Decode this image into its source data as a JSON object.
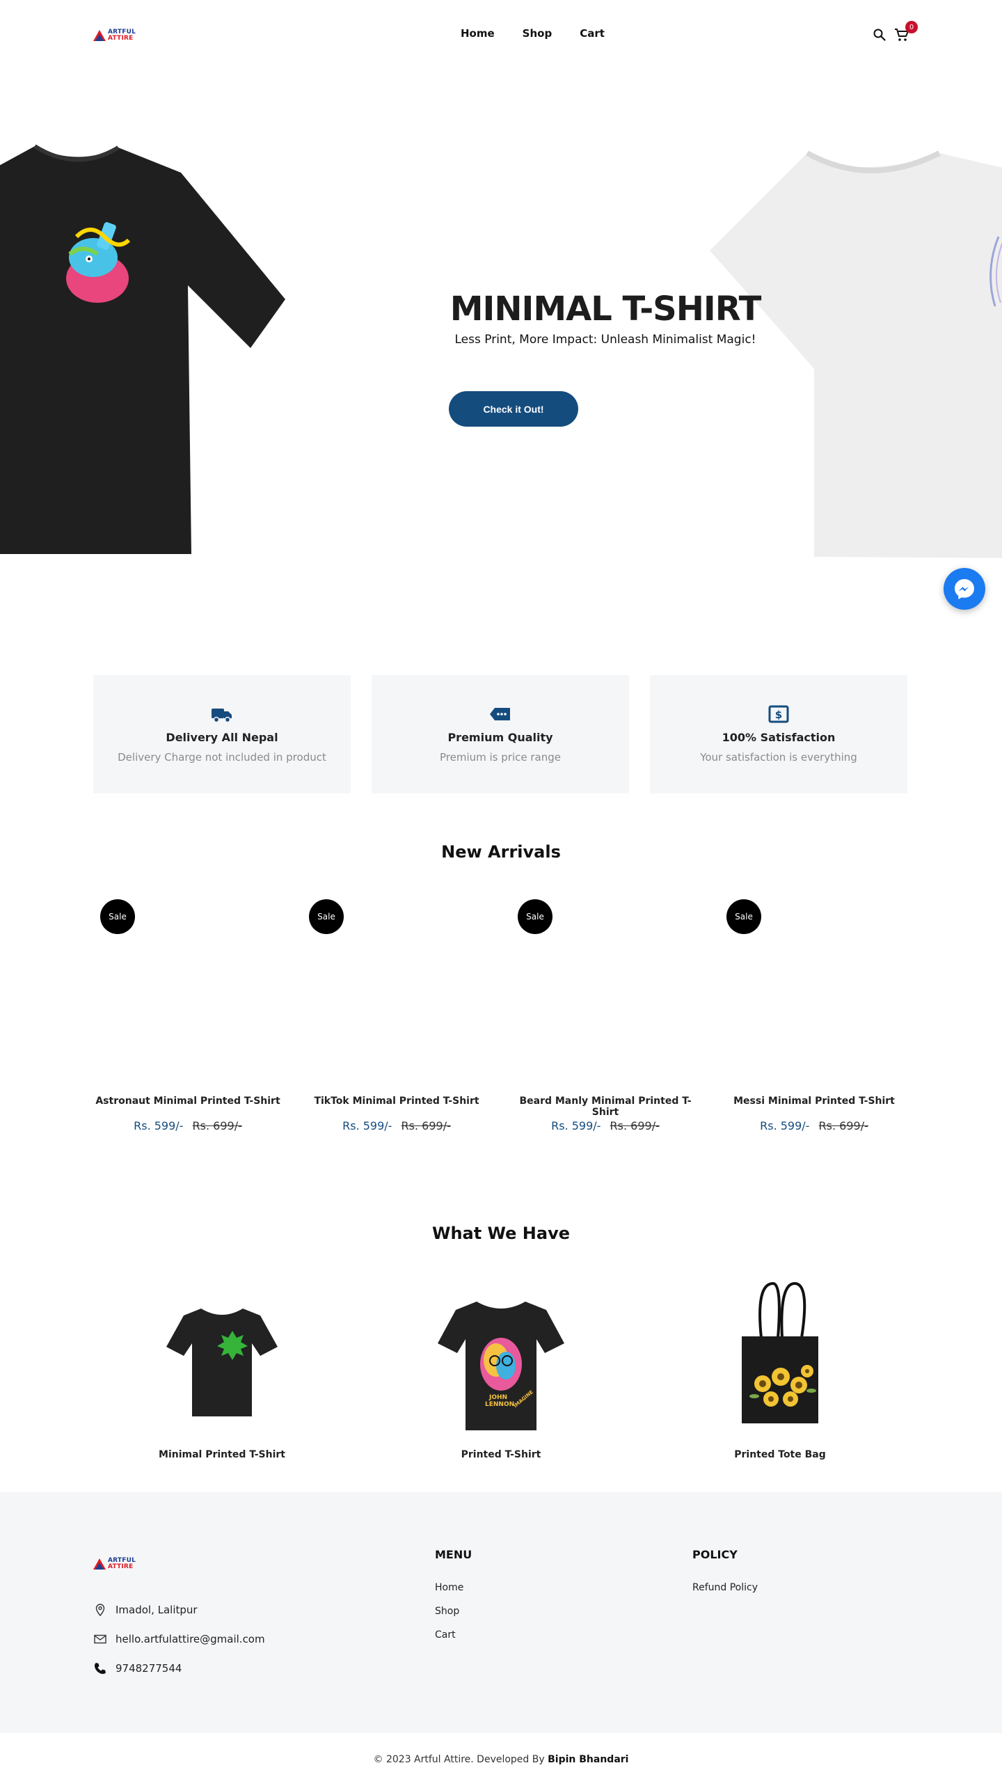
{
  "brand": {
    "line1": "ARTFUL",
    "line2": "ATTIRE"
  },
  "nav": {
    "items": [
      "Home",
      "Shop",
      "Cart"
    ]
  },
  "header": {
    "cart_count": "0"
  },
  "hero": {
    "title": "MINIMAL T-SHIRT",
    "subtitle": "Less Print, More Impact: Unleash Minimalist Magic!",
    "button_label": "Check it Out!"
  },
  "features": [
    {
      "icon": "truck-icon",
      "title": "Delivery All Nepal",
      "text": "Delivery Charge not included in product"
    },
    {
      "icon": "tag-icon",
      "title": "Premium Quality",
      "text": "Premium is price range"
    },
    {
      "icon": "dollar-icon",
      "title": "100% Satisfaction",
      "text": "Your satisfaction is everything"
    }
  ],
  "new_arrivals": {
    "title": "New Arrivals",
    "badge": "Sale",
    "items": [
      {
        "name": "Astronaut Minimal Printed T-Shirt",
        "price": "Rs. 599/-",
        "old_price": "Rs. 699/-"
      },
      {
        "name": "TikTok Minimal Printed T-Shirt",
        "price": "Rs. 599/-",
        "old_price": "Rs. 699/-"
      },
      {
        "name": "Beard Manly Minimal Printed T-Shirt",
        "price": "Rs. 599/-",
        "old_price": "Rs. 699/-"
      },
      {
        "name": "Messi Minimal Printed T-Shirt",
        "price": "Rs. 599/-",
        "old_price": "Rs. 699/-"
      }
    ]
  },
  "what_we_have": {
    "title": "What We Have",
    "items": [
      {
        "name": "Minimal Printed T-Shirt"
      },
      {
        "name": "Printed T-Shirt",
        "print_text_1": "JOHN",
        "print_text_2": "LENNON",
        "print_text_3": "IMAGINE"
      },
      {
        "name": "Printed Tote Bag"
      }
    ]
  },
  "footer": {
    "address": "Imadol, Lalitpur",
    "email": "hello.artfulattire@gmail.com",
    "phone": "9748277544",
    "menu_title": "MENU",
    "menu": [
      "Home",
      "Shop",
      "Cart"
    ],
    "policy_title": "POLICY",
    "policy": [
      "Refund Policy"
    ],
    "copyright": "© 2023 Artful Attire. Developed By",
    "developer": "Bipin Bhandari"
  },
  "colors": {
    "accent": "#154c7e",
    "badge": "#c8102e",
    "messenger": "#1b7bf0",
    "panel": "#f5f6f8"
  }
}
